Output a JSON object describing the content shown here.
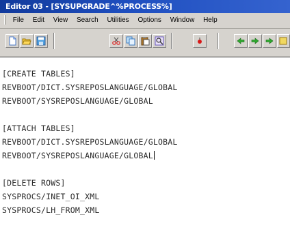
{
  "window": {
    "title": "Editor 03 - [SYSUPGRADE^%PROCESS%]"
  },
  "menu": {
    "items": [
      "File",
      "Edit",
      "View",
      "Search",
      "Utilities",
      "Options",
      "Window",
      "Help"
    ]
  },
  "toolbar": {
    "buttons": [
      "new-file-icon",
      "open-folder-icon",
      "save-icon",
      "cut-icon",
      "copy-icon",
      "paste-icon",
      "find-icon",
      "record-icon",
      "prev-icon",
      "next-icon",
      "goto-icon"
    ]
  },
  "editor": {
    "lines": [
      "[CREATE TABLES]",
      "REVBOOT/DICT.SYSREPOSLANGUAGE/GLOBAL",
      "REVBOOT/SYSREPOSLANGUAGE/GLOBAL",
      "",
      "[ATTACH TABLES]",
      "REVBOOT/DICT.SYSREPOSLANGUAGE/GLOBAL",
      "REVBOOT/SYSREPOSLANGUAGE/GLOBAL",
      "",
      "[DELETE ROWS]",
      "SYSPROCS/INET_OI_XML",
      "SYSPROCS/LH_FROM_XML"
    ]
  }
}
